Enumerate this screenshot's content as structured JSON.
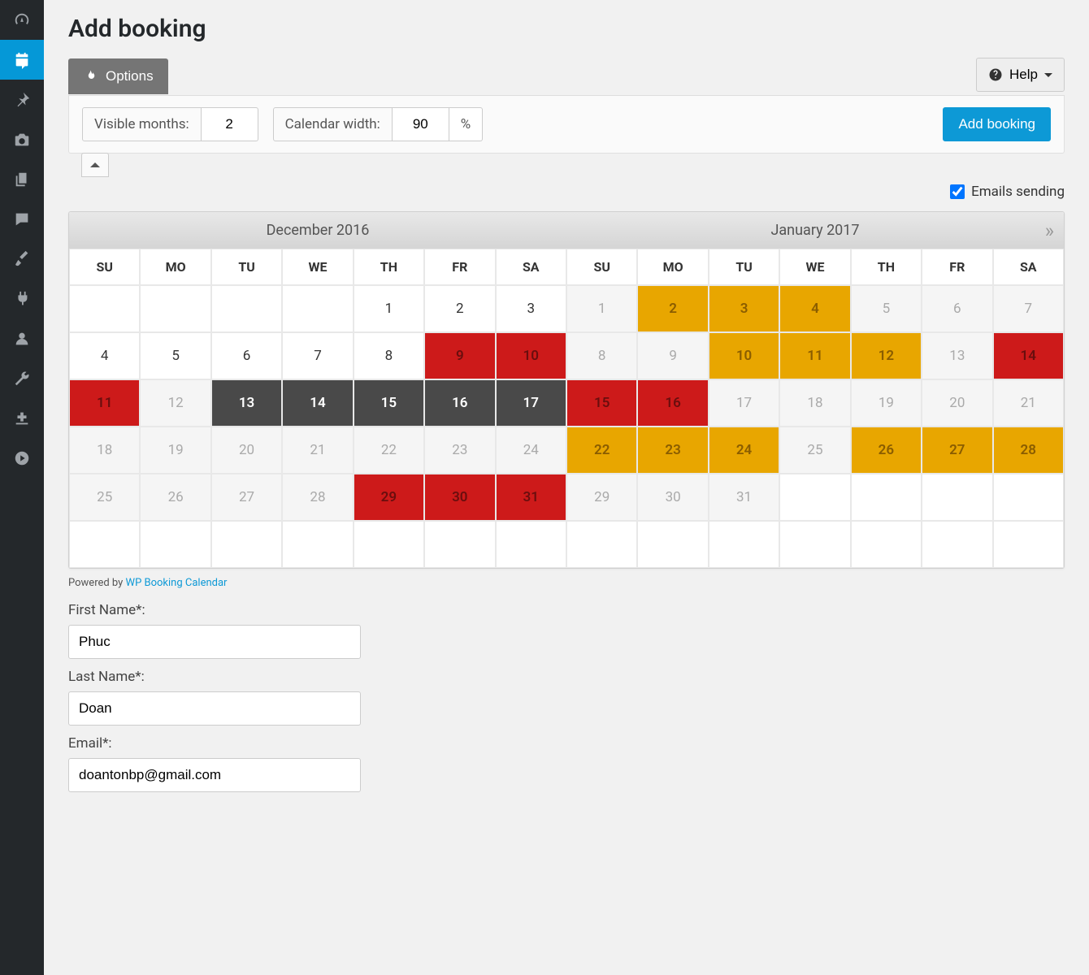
{
  "page": {
    "title": "Add booking"
  },
  "toolbar": {
    "options_label": "Options",
    "help_label": "Help",
    "visible_months_label": "Visible months:",
    "visible_months_value": "2",
    "calendar_width_label": "Calendar width:",
    "calendar_width_value": "90",
    "calendar_width_unit": "%",
    "add_booking_label": "Add booking",
    "emails_sending_label": "Emails sending",
    "emails_sending_checked": true
  },
  "calendar": {
    "dow": [
      "SU",
      "MO",
      "TU",
      "WE",
      "TH",
      "FR",
      "SA"
    ],
    "months": [
      {
        "title": "December 2016",
        "weeks": [
          [
            {
              "d": "",
              "s": "empty"
            },
            {
              "d": "",
              "s": "empty"
            },
            {
              "d": "",
              "s": "empty"
            },
            {
              "d": "",
              "s": "empty"
            },
            {
              "d": "1",
              "s": ""
            },
            {
              "d": "2",
              "s": ""
            },
            {
              "d": "3",
              "s": ""
            }
          ],
          [
            {
              "d": "4",
              "s": ""
            },
            {
              "d": "5",
              "s": ""
            },
            {
              "d": "6",
              "s": ""
            },
            {
              "d": "7",
              "s": ""
            },
            {
              "d": "8",
              "s": ""
            },
            {
              "d": "9",
              "s": "red"
            },
            {
              "d": "10",
              "s": "red"
            }
          ],
          [
            {
              "d": "11",
              "s": "red"
            },
            {
              "d": "12",
              "s": "past"
            },
            {
              "d": "13",
              "s": "dark"
            },
            {
              "d": "14",
              "s": "dark"
            },
            {
              "d": "15",
              "s": "dark"
            },
            {
              "d": "16",
              "s": "dark"
            },
            {
              "d": "17",
              "s": "dark"
            }
          ],
          [
            {
              "d": "18",
              "s": "past"
            },
            {
              "d": "19",
              "s": "past"
            },
            {
              "d": "20",
              "s": "past"
            },
            {
              "d": "21",
              "s": "past"
            },
            {
              "d": "22",
              "s": "past"
            },
            {
              "d": "23",
              "s": "past"
            },
            {
              "d": "24",
              "s": "past"
            }
          ],
          [
            {
              "d": "25",
              "s": "past"
            },
            {
              "d": "26",
              "s": "past"
            },
            {
              "d": "27",
              "s": "past"
            },
            {
              "d": "28",
              "s": "past"
            },
            {
              "d": "29",
              "s": "red"
            },
            {
              "d": "30",
              "s": "red"
            },
            {
              "d": "31",
              "s": "red"
            }
          ],
          [
            {
              "d": "",
              "s": "empty"
            },
            {
              "d": "",
              "s": "empty"
            },
            {
              "d": "",
              "s": "empty"
            },
            {
              "d": "",
              "s": "empty"
            },
            {
              "d": "",
              "s": "empty"
            },
            {
              "d": "",
              "s": "empty"
            },
            {
              "d": "",
              "s": "empty"
            }
          ]
        ]
      },
      {
        "title": "January 2017",
        "weeks": [
          [
            {
              "d": "1",
              "s": "past"
            },
            {
              "d": "2",
              "s": "orange"
            },
            {
              "d": "3",
              "s": "orange"
            },
            {
              "d": "4",
              "s": "orange"
            },
            {
              "d": "5",
              "s": "past"
            },
            {
              "d": "6",
              "s": "past"
            },
            {
              "d": "7",
              "s": "past"
            }
          ],
          [
            {
              "d": "8",
              "s": "past"
            },
            {
              "d": "9",
              "s": "past"
            },
            {
              "d": "10",
              "s": "orange"
            },
            {
              "d": "11",
              "s": "orange"
            },
            {
              "d": "12",
              "s": "orange"
            },
            {
              "d": "13",
              "s": "past"
            },
            {
              "d": "14",
              "s": "red"
            }
          ],
          [
            {
              "d": "15",
              "s": "red"
            },
            {
              "d": "16",
              "s": "red"
            },
            {
              "d": "17",
              "s": "past"
            },
            {
              "d": "18",
              "s": "past"
            },
            {
              "d": "19",
              "s": "past"
            },
            {
              "d": "20",
              "s": "past"
            },
            {
              "d": "21",
              "s": "past"
            }
          ],
          [
            {
              "d": "22",
              "s": "orange"
            },
            {
              "d": "23",
              "s": "orange"
            },
            {
              "d": "24",
              "s": "orange"
            },
            {
              "d": "25",
              "s": "past"
            },
            {
              "d": "26",
              "s": "orange"
            },
            {
              "d": "27",
              "s": "orange"
            },
            {
              "d": "28",
              "s": "orange"
            }
          ],
          [
            {
              "d": "29",
              "s": "past"
            },
            {
              "d": "30",
              "s": "past"
            },
            {
              "d": "31",
              "s": "past"
            },
            {
              "d": "",
              "s": "empty"
            },
            {
              "d": "",
              "s": "empty"
            },
            {
              "d": "",
              "s": "empty"
            },
            {
              "d": "",
              "s": "empty"
            }
          ],
          [
            {
              "d": "",
              "s": "empty"
            },
            {
              "d": "",
              "s": "empty"
            },
            {
              "d": "",
              "s": "empty"
            },
            {
              "d": "",
              "s": "empty"
            },
            {
              "d": "",
              "s": "empty"
            },
            {
              "d": "",
              "s": "empty"
            },
            {
              "d": "",
              "s": "empty"
            }
          ]
        ]
      }
    ]
  },
  "powered": {
    "prefix": "Powered by ",
    "link_text": "WP Booking Calendar"
  },
  "form": {
    "first_name_label": "First Name*:",
    "first_name_value": "Phuc",
    "last_name_label": "Last Name*:",
    "last_name_value": "Doan",
    "email_label": "Email*:",
    "email_value": "doantonbp@gmail.com"
  },
  "sidebar_icons": [
    "dashboard",
    "calendar-edit",
    "pin",
    "camera",
    "copy",
    "comment",
    "brush",
    "plug",
    "user",
    "wrench",
    "import",
    "play"
  ]
}
